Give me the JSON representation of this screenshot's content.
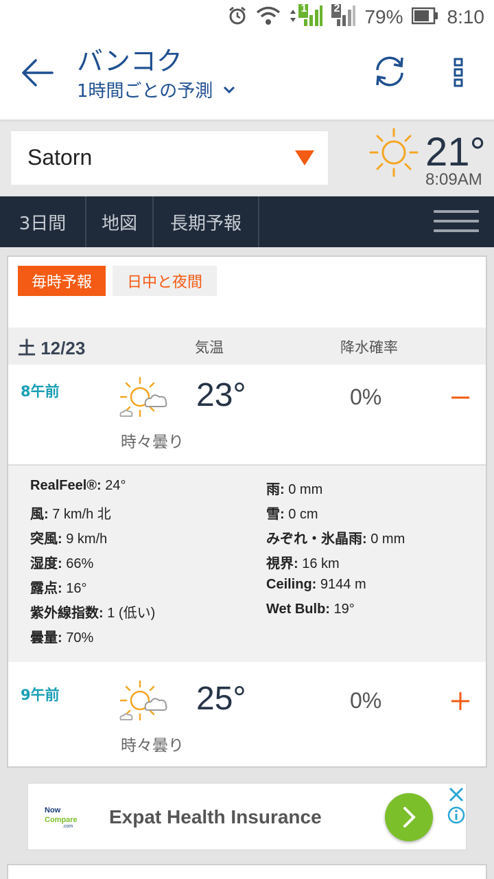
{
  "status_bar": {
    "battery": "79%",
    "time": "8:10",
    "sim1": "1",
    "sim2": "2",
    "icons": [
      "alarm-icon",
      "wifi-icon",
      "signal-icon",
      "battery-icon"
    ]
  },
  "header": {
    "title": "バンコク",
    "subtitle": "1時間ごとの予測",
    "icons": [
      "back-arrow-icon",
      "refresh-icon",
      "overflow-menu-icon"
    ]
  },
  "location": {
    "name": "Satorn",
    "current_temp": "21°",
    "current_time": "8:09AM",
    "icon": "sunny-icon"
  },
  "nav": {
    "tabs": [
      "3日間",
      "地図",
      "長期予報"
    ],
    "icon": "hamburger-menu-icon"
  },
  "forecast": {
    "mode_tabs": [
      "毎時予報",
      "日中と夜間"
    ],
    "date": "土 12/23",
    "col_temp": "気温",
    "col_precip": "降水確率",
    "hours": [
      {
        "time": "8午前",
        "temp": "23°",
        "precip": "0%",
        "phrase": "時々曇り",
        "icon": "partly-cloudy-icon",
        "toggle": "collapse"
      },
      {
        "time": "9午前",
        "temp": "25°",
        "precip": "0%",
        "phrase": "時々曇り",
        "icon": "partly-cloudy-icon",
        "toggle": "expand"
      }
    ],
    "details_left": [
      {
        "label": "RealFeel®:",
        "value": " 24°"
      },
      {
        "label": "風:",
        "value": " 7 km/h 北"
      },
      {
        "label": "突風:",
        "value": " 9 km/h"
      },
      {
        "label": "湿度:",
        "value": " 66%"
      },
      {
        "label": "露点:",
        "value": " 16°"
      },
      {
        "label": "紫外線指数:",
        "value": " 1 (低い)"
      },
      {
        "label": "曇量:",
        "value": " 70%"
      }
    ],
    "details_right": [
      {
        "label": "雨:",
        "value": " 0 mm"
      },
      {
        "label": "雪:",
        "value": " 0 cm"
      },
      {
        "label": "みぞれ・氷晶雨:",
        "value": " 0 mm"
      },
      {
        "label": "視界:",
        "value": " 16 km"
      },
      {
        "label": "Ceiling:",
        "value": " 9144 m"
      },
      {
        "label": "Wet Bulb:",
        "value": " 19°"
      }
    ]
  },
  "ad": {
    "logo_top": "Now",
    "logo_bottom": "Compare",
    "logo_suffix": ".com",
    "text": "Expat Health Insurance"
  },
  "colors": {
    "accent": "#f45b14",
    "title_blue": "#1e5091",
    "nav_bg": "#1f2a3a",
    "hour_label": "#1a9fb5",
    "sun": "#f5a623"
  }
}
